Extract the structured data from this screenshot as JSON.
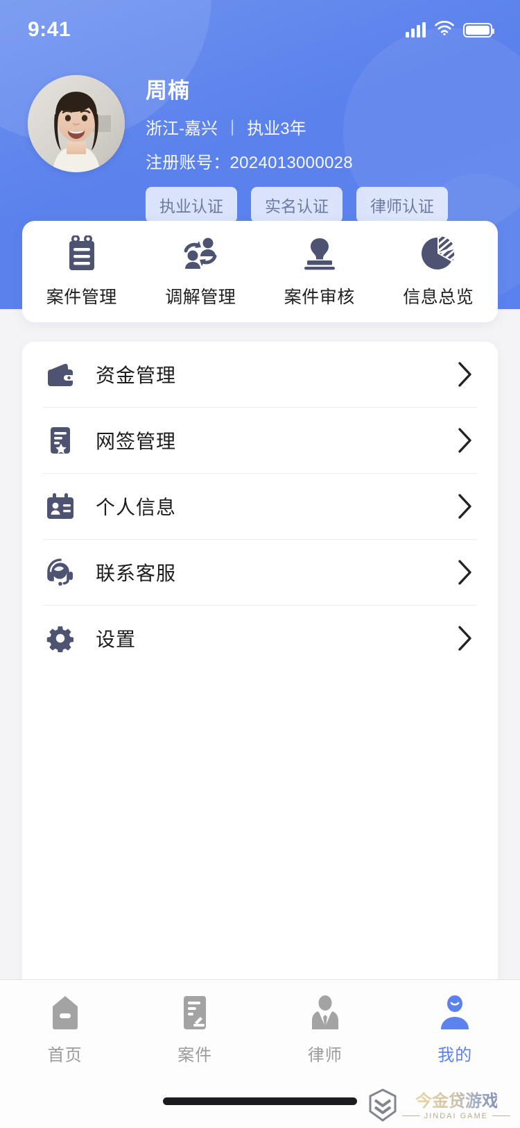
{
  "status_bar": {
    "time": "9:41",
    "signal_icon": "signal-bars-icon",
    "wifi_icon": "wifi-icon",
    "battery_icon": "battery-full-icon"
  },
  "profile": {
    "avatar_alt": "user-avatar-photo",
    "name": "周楠",
    "region": "浙江-嘉兴",
    "separator": "|",
    "experience": "执业3年",
    "account_label": "注册账号：",
    "account_number": "2024013000028",
    "account_full": "注册账号：2024013000028",
    "badges": [
      {
        "label": "执业认证",
        "name": "practice-certification"
      },
      {
        "label": "实名认证",
        "name": "realname-certification"
      },
      {
        "label": "律师认证",
        "name": "lawyer-certification"
      }
    ]
  },
  "quick_actions": [
    {
      "label": "案件管理",
      "icon": "clipboard-icon"
    },
    {
      "label": "调解管理",
      "icon": "mediation-people-icon"
    },
    {
      "label": "案件审核",
      "icon": "stamp-icon"
    },
    {
      "label": "信息总览",
      "icon": "pie-chart-icon"
    }
  ],
  "menu_items": [
    {
      "label": "资金管理",
      "icon": "wallet-icon"
    },
    {
      "label": "网签管理",
      "icon": "document-star-icon"
    },
    {
      "label": "个人信息",
      "icon": "id-card-icon"
    },
    {
      "label": "联系客服",
      "icon": "headset-icon"
    },
    {
      "label": "设置",
      "icon": "gear-icon"
    }
  ],
  "tab_bar": [
    {
      "label": "首页",
      "icon": "home-icon",
      "active": false
    },
    {
      "label": "案件",
      "icon": "case-gavel-icon",
      "active": false
    },
    {
      "label": "律师",
      "icon": "lawyer-icon",
      "active": false
    },
    {
      "label": "我的",
      "icon": "person-icon",
      "active": true
    }
  ],
  "watermark": {
    "title": "今金贷游戏",
    "subtitle": "JINDAI GAME",
    "logo": "shield-chevron-logo"
  },
  "colors": {
    "header_blue": "#5b81ec",
    "accent": "#5b82ee",
    "icon_navy": "#4e5372",
    "page_bg": "#f4f4f6",
    "card_bg": "#ffffff",
    "tab_inactive": "#9b9b9b"
  }
}
